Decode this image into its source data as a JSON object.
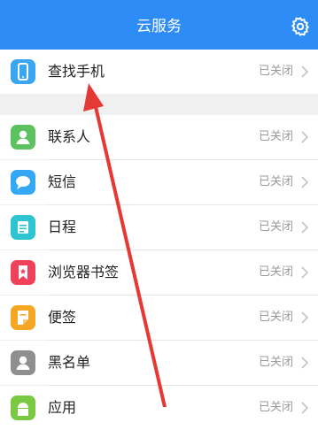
{
  "header": {
    "title": "云服务"
  },
  "colors": {
    "header_bg": "#2d8cf6",
    "annotation_arrow": "#e53935"
  },
  "rows": [
    {
      "label": "查找手机",
      "status": "已关闭",
      "icon": "phone-icon",
      "color": "#3aa6f2"
    },
    {
      "label": "联系人",
      "status": "已关闭",
      "icon": "contacts-icon",
      "color": "#5cc15f"
    },
    {
      "label": "短信",
      "status": "已关闭",
      "icon": "message-icon",
      "color": "#35a8f5"
    },
    {
      "label": "日程",
      "status": "已关闭",
      "icon": "calendar-icon",
      "color": "#2fc4d1"
    },
    {
      "label": "浏览器书签",
      "status": "已关闭",
      "icon": "bookmark-icon",
      "color": "#f0405a"
    },
    {
      "label": "便签",
      "status": "已关闭",
      "icon": "note-icon",
      "color": "#f5a623"
    },
    {
      "label": "黑名单",
      "status": "已关闭",
      "icon": "blacklist-icon",
      "color": "#8f8f8f"
    },
    {
      "label": "应用",
      "status": "已关闭",
      "icon": "apps-icon",
      "color": "#7ac943"
    }
  ]
}
